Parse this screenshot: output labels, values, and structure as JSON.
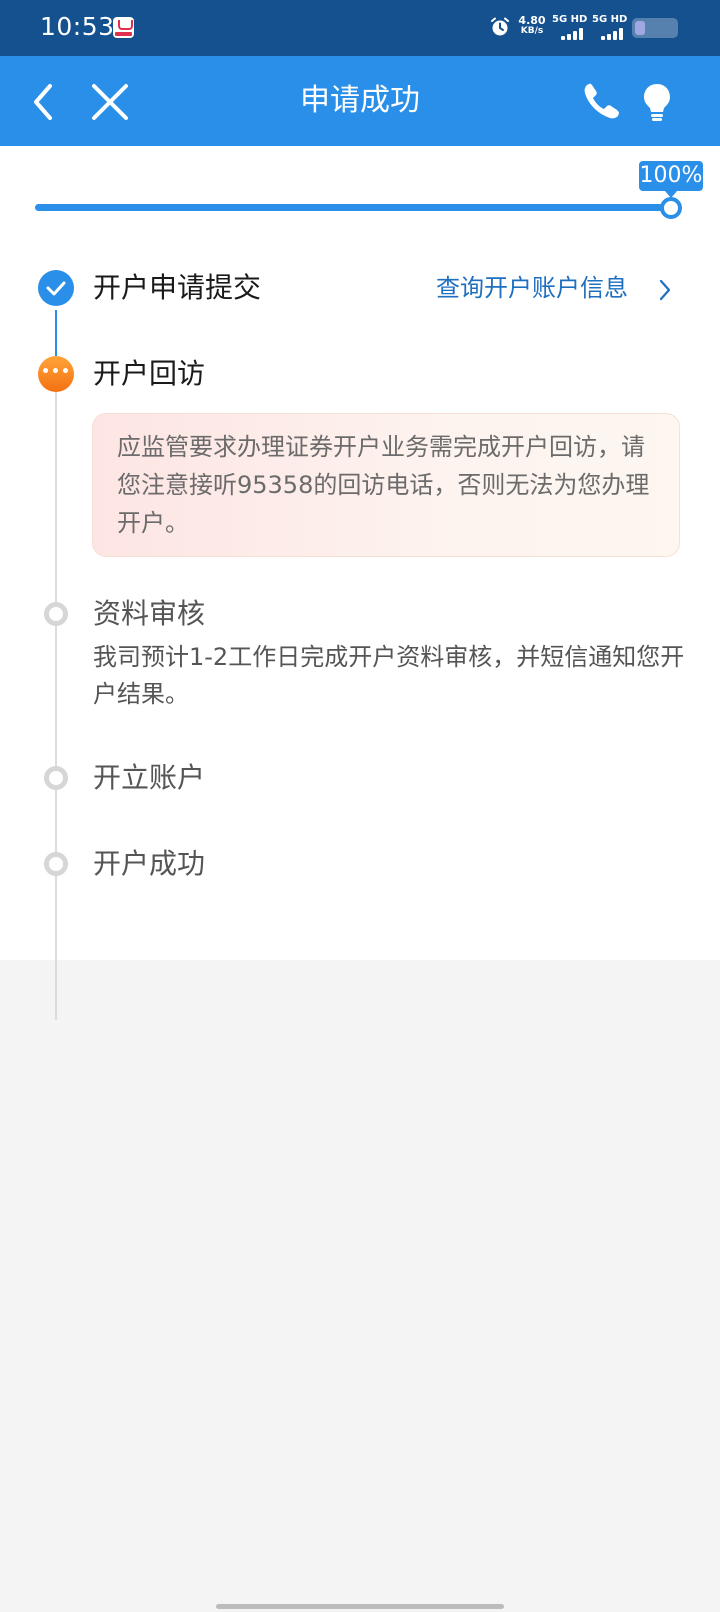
{
  "status_bar": {
    "time": "10:53",
    "net_speed_value": "4.80",
    "net_speed_unit": "KB/s",
    "sim1_label": "5G HD",
    "sim2_label": "5G HD",
    "icons": [
      "app-notification-icon",
      "alarm-icon",
      "signal-icon",
      "battery-icon"
    ]
  },
  "header": {
    "title": "申请成功",
    "icons": [
      "back-icon",
      "close-icon",
      "phone-icon",
      "lightbulb-icon"
    ],
    "bg_color": "#2a8fe8"
  },
  "progress": {
    "label": "100%",
    "value": 1.0
  },
  "steps": [
    {
      "title": "开户申请提交",
      "status": "done",
      "link": "查询开户账户信息"
    },
    {
      "title": "开户回访",
      "status": "active",
      "notice": "应监管要求办理证券开户业务需完成开户回访，请您注意接听95358的回访电话，否则无法为您办理开户。"
    },
    {
      "title": "资料审核",
      "status": "pending",
      "description": "我司预计1-2工作日完成开户资料审核，并短信通知您开户结果。"
    },
    {
      "title": "开立账户",
      "status": "pending"
    },
    {
      "title": "开户成功",
      "status": "pending"
    }
  ],
  "colors": {
    "primary": "#2a8fe8",
    "active": "#f47112",
    "pending": "#d6d6d6",
    "link": "#1f6fc0"
  }
}
